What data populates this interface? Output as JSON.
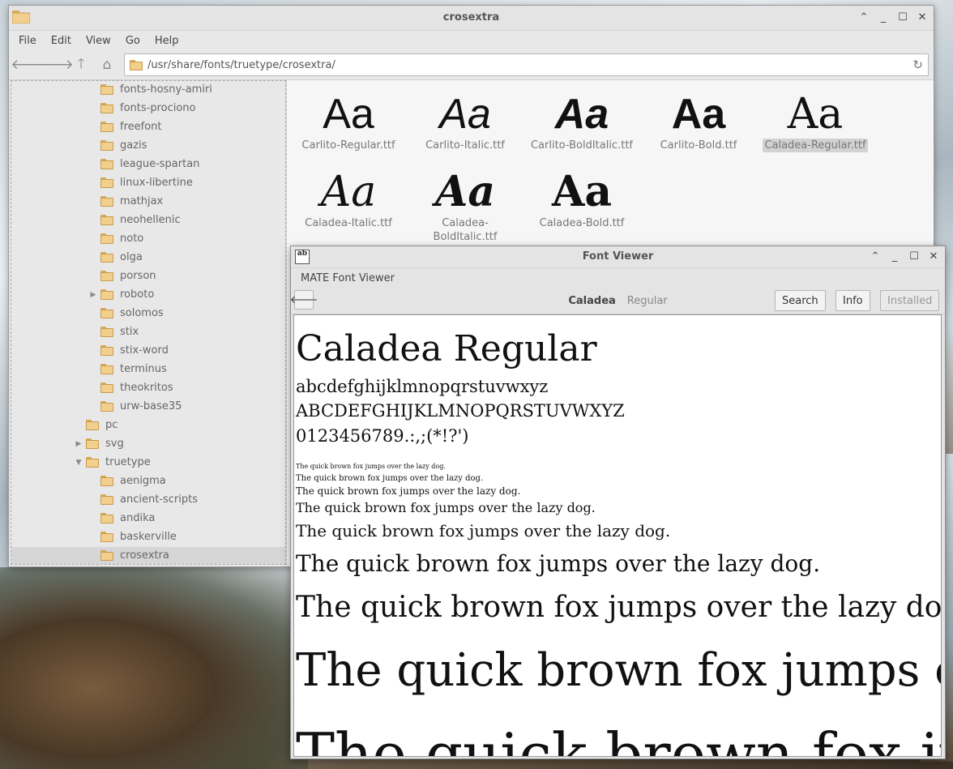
{
  "file_manager": {
    "title": "crosextra",
    "menu": [
      "File",
      "Edit",
      "View",
      "Go",
      "Help"
    ],
    "path": "/usr/share/fonts/truetype/crosextra/",
    "tree": [
      {
        "label": "fonts-hosny-amiri",
        "depth": 2,
        "expander": ""
      },
      {
        "label": "fonts-prociono",
        "depth": 2,
        "expander": ""
      },
      {
        "label": "freefont",
        "depth": 2,
        "expander": ""
      },
      {
        "label": "gazis",
        "depth": 2,
        "expander": ""
      },
      {
        "label": "league-spartan",
        "depth": 2,
        "expander": ""
      },
      {
        "label": "linux-libertine",
        "depth": 2,
        "expander": ""
      },
      {
        "label": "mathjax",
        "depth": 2,
        "expander": ""
      },
      {
        "label": "neohellenic",
        "depth": 2,
        "expander": ""
      },
      {
        "label": "noto",
        "depth": 2,
        "expander": ""
      },
      {
        "label": "olga",
        "depth": 2,
        "expander": ""
      },
      {
        "label": "porson",
        "depth": 2,
        "expander": ""
      },
      {
        "label": "roboto",
        "depth": 2,
        "expander": "▶"
      },
      {
        "label": "solomos",
        "depth": 2,
        "expander": ""
      },
      {
        "label": "stix",
        "depth": 2,
        "expander": ""
      },
      {
        "label": "stix-word",
        "depth": 2,
        "expander": ""
      },
      {
        "label": "terminus",
        "depth": 2,
        "expander": ""
      },
      {
        "label": "theokritos",
        "depth": 2,
        "expander": ""
      },
      {
        "label": "urw-base35",
        "depth": 2,
        "expander": ""
      },
      {
        "label": "pc",
        "depth": 1,
        "expander": ""
      },
      {
        "label": "svg",
        "depth": 1,
        "expander": "▶"
      },
      {
        "label": "truetype",
        "depth": 1,
        "expander": "▼"
      },
      {
        "label": "aenigma",
        "depth": 2,
        "expander": ""
      },
      {
        "label": "ancient-scripts",
        "depth": 2,
        "expander": ""
      },
      {
        "label": "andika",
        "depth": 2,
        "expander": ""
      },
      {
        "label": "baskerville",
        "depth": 2,
        "expander": ""
      },
      {
        "label": "crosextra",
        "depth": 2,
        "expander": "",
        "selected": true
      }
    ],
    "files": [
      {
        "glyph": "Aa",
        "name": "Carlito-Regular.ttf",
        "style": "regular"
      },
      {
        "glyph": "Aa",
        "name": "Carlito-Italic.ttf",
        "style": "italic"
      },
      {
        "glyph": "Aa",
        "name": "Carlito-BoldItalic.ttf",
        "style": "bolditalic"
      },
      {
        "glyph": "Aa",
        "name": "Carlito-Bold.ttf",
        "style": "bold"
      },
      {
        "glyph": "Aa",
        "name": "Caladea-Regular.ttf",
        "style": "serif",
        "selected": true
      },
      {
        "glyph": "Aa",
        "name": "Caladea-Italic.ttf",
        "style": "serif-italic"
      },
      {
        "glyph": "Aa",
        "name": "Caladea-BoldItalic.ttf",
        "name_lines": [
          "Caladea-",
          "BoldItalic.ttf"
        ],
        "style": "serif-bolditalic"
      },
      {
        "glyph": "Aa",
        "name": "Caladea-Bold.ttf",
        "style": "serif-bold"
      }
    ]
  },
  "font_viewer": {
    "title": "Font Viewer",
    "app_icon_text": "ab",
    "menu_label": "MATE Font Viewer",
    "font_family": "Caladea",
    "font_style": "Regular",
    "buttons": {
      "search": "Search",
      "info": "Info",
      "installed": "Installed"
    },
    "preview": {
      "heading": "Caladea Regular",
      "lower": "abcdefghijklmnopqrstuvwxyz",
      "upper": "ABCDEFGHIJKLMNOPQRSTUVWXYZ",
      "digits": "0123456789.:,;(*!?')",
      "sample": "The quick brown fox jumps over the lazy dog."
    }
  }
}
